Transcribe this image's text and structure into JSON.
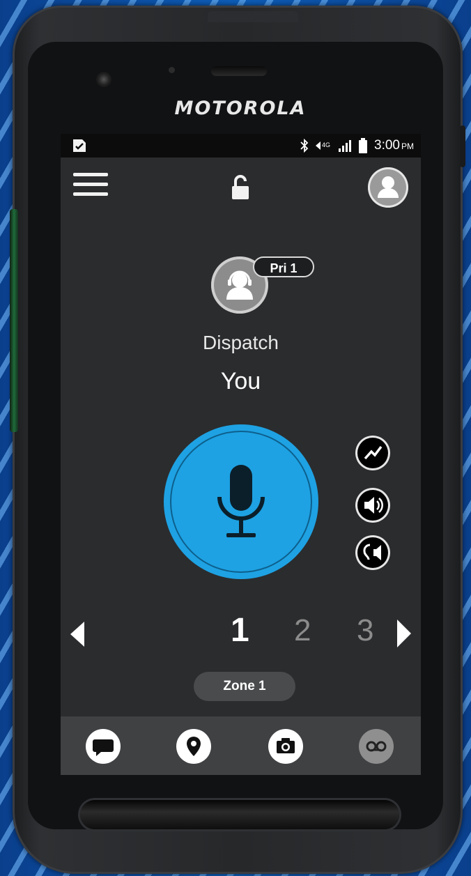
{
  "device": {
    "brand": "MOTOROLA"
  },
  "statusbar": {
    "time": "3:00",
    "ampm": "PM",
    "icons": [
      "sim-card-icon",
      "bluetooth-icon",
      "lte-icon",
      "signal-icon",
      "battery-icon"
    ]
  },
  "appbar": {
    "menu_icon": "hamburger-menu-icon",
    "lock_icon": "unlocked-padlock-icon",
    "profile_icon": "user-profile-icon"
  },
  "contact": {
    "priority": "Pri 1",
    "talkgroup": "Dispatch",
    "talker": "You",
    "avatar_icon": "headset-user-icon"
  },
  "ptt": {
    "icon": "microphone-icon",
    "color": "#1ea2e3"
  },
  "side_controls": [
    {
      "name": "signal-quality-icon"
    },
    {
      "name": "speaker-volume-icon"
    },
    {
      "name": "earpiece-audio-icon"
    }
  ],
  "channels": {
    "items": [
      "1",
      "2",
      "3"
    ],
    "active_index": 0
  },
  "zone": {
    "label": "Zone 1"
  },
  "bottom_nav": [
    {
      "name": "messages-icon"
    },
    {
      "name": "location-pin-icon"
    },
    {
      "name": "camera-icon"
    },
    {
      "name": "voicemail-icon"
    }
  ]
}
